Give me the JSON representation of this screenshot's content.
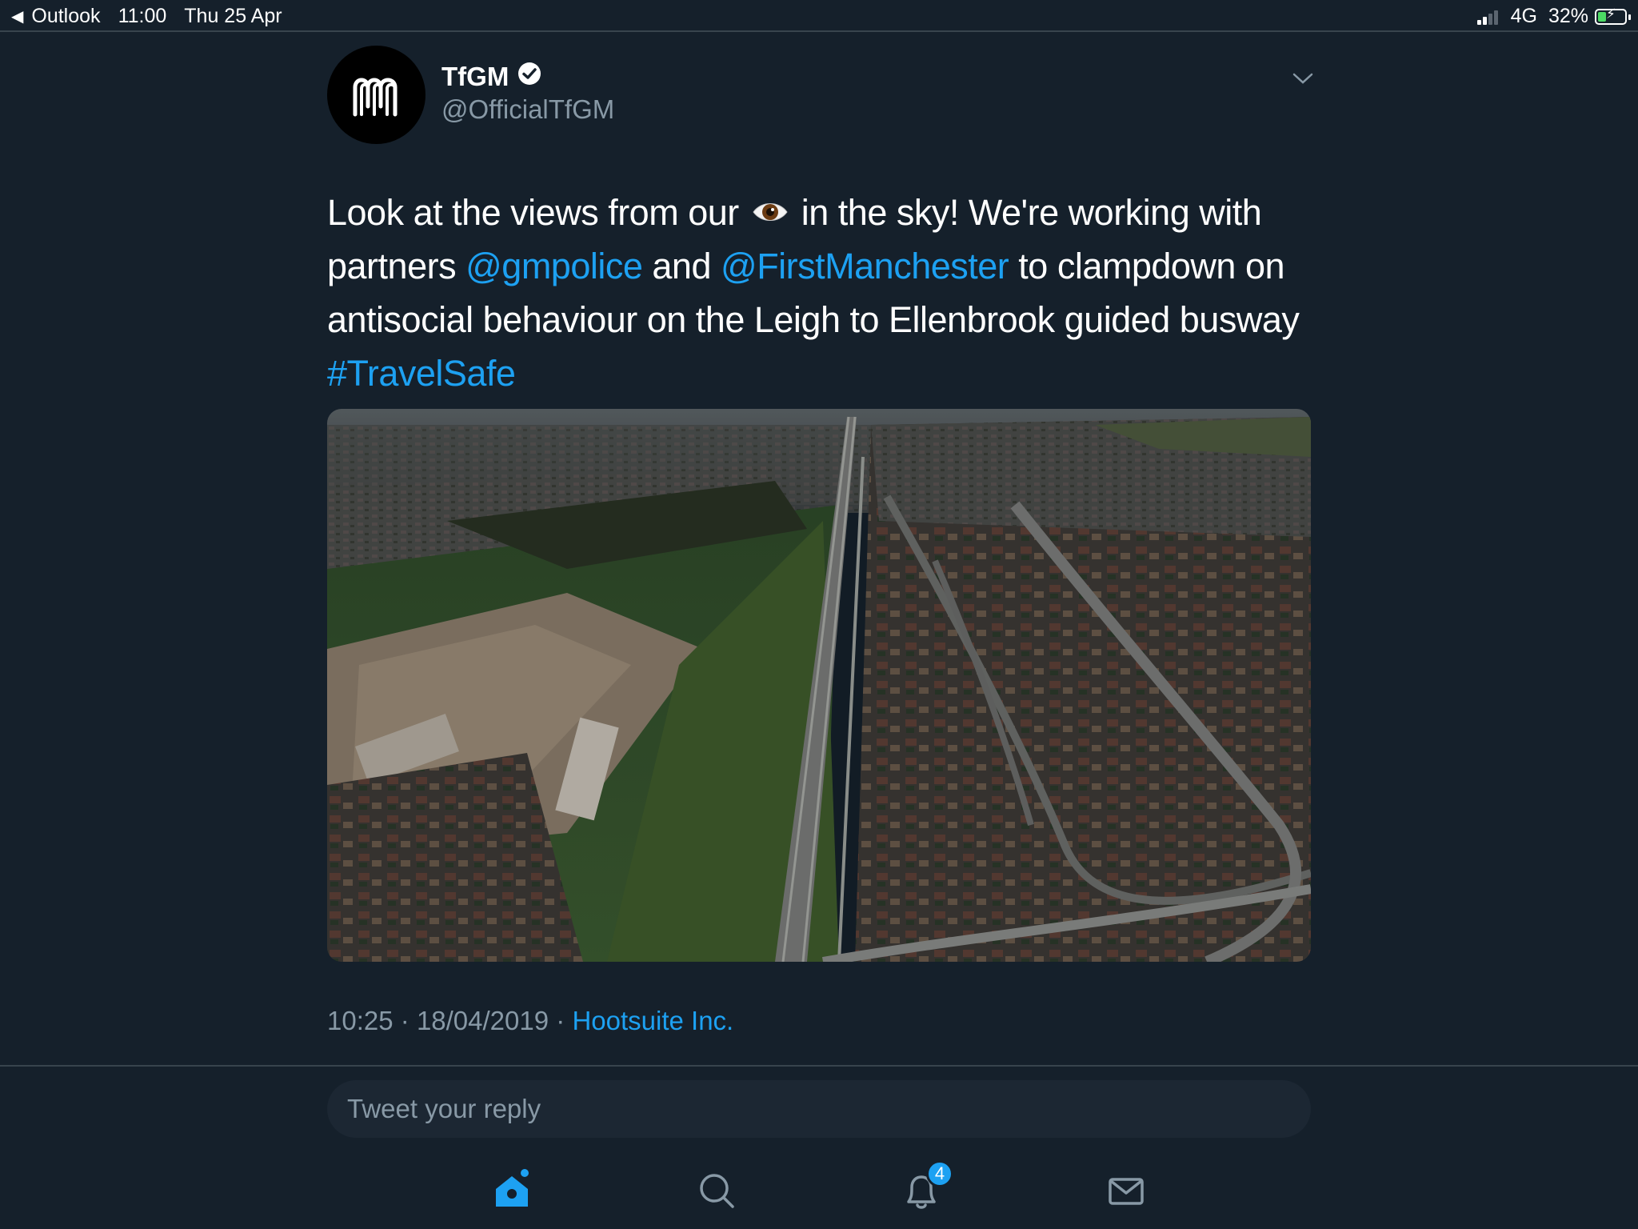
{
  "status_bar": {
    "back_app": "Outlook",
    "time": "11:00",
    "date": "Thu 25 Apr",
    "network": "4G",
    "battery": "32%",
    "battery_level": 0.32
  },
  "tweet": {
    "author_name": "TfGM",
    "handle": "@OfficialTfGM",
    "text_1": "Look at the views from our",
    "text_2": "in the sky! We're working with partners",
    "mention_1": "@gmpolice",
    "text_3": "and",
    "mention_2": "@FirstManchester",
    "text_4": "to clampdown on antisocial behaviour on the Leigh to Ellenbrook guided busway",
    "hashtag": "#TravelSafe",
    "emoji": "eye-emoji",
    "time": "10:25",
    "separator": "·",
    "date": "18/04/2019",
    "source": "Hootsuite Inc."
  },
  "reply": {
    "placeholder": "Tweet your reply"
  },
  "tabbar": {
    "notifications_badge": "4"
  },
  "colors": {
    "background": "#15202b",
    "accent": "#1da1f2",
    "secondary_text": "#8899a6",
    "divider": "#38444d"
  }
}
